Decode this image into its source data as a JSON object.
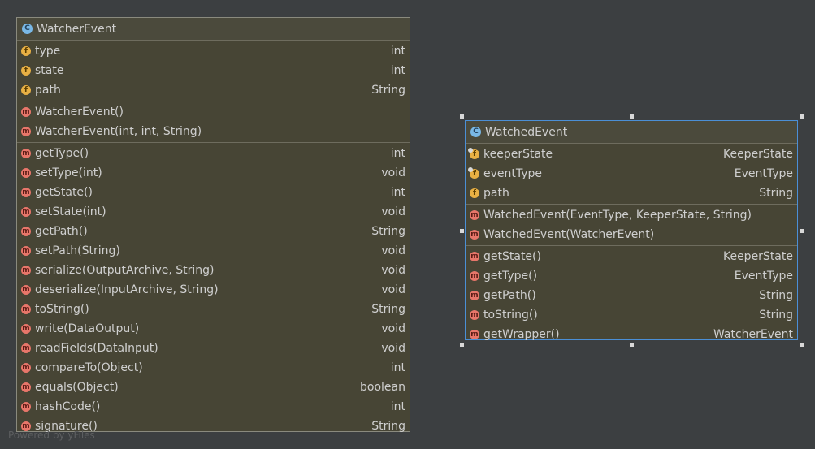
{
  "watcher": {
    "title": "WatcherEvent",
    "fields": [
      {
        "name": "type",
        "type": "int"
      },
      {
        "name": "state",
        "type": "int"
      },
      {
        "name": "path",
        "type": "String"
      }
    ],
    "constructors": [
      {
        "name": "WatcherEvent()",
        "type": ""
      },
      {
        "name": "WatcherEvent(int, int, String)",
        "type": ""
      }
    ],
    "methods": [
      {
        "name": "getType()",
        "type": "int"
      },
      {
        "name": "setType(int)",
        "type": "void"
      },
      {
        "name": "getState()",
        "type": "int"
      },
      {
        "name": "setState(int)",
        "type": "void"
      },
      {
        "name": "getPath()",
        "type": "String"
      },
      {
        "name": "setPath(String)",
        "type": "void"
      },
      {
        "name": "serialize(OutputArchive, String)",
        "type": "void"
      },
      {
        "name": "deserialize(InputArchive, String)",
        "type": "void"
      },
      {
        "name": "toString()",
        "type": "String"
      },
      {
        "name": "write(DataOutput)",
        "type": "void"
      },
      {
        "name": "readFields(DataInput)",
        "type": "void"
      },
      {
        "name": "compareTo(Object)",
        "type": "int"
      },
      {
        "name": "equals(Object)",
        "type": "boolean"
      },
      {
        "name": "hashCode()",
        "type": "int"
      },
      {
        "name": "signature()",
        "type": "String"
      }
    ]
  },
  "watched": {
    "title": "WatchedEvent",
    "fields": [
      {
        "name": "keeperState",
        "type": "KeeperState"
      },
      {
        "name": "eventType",
        "type": "EventType"
      },
      {
        "name": "path",
        "type": "String"
      }
    ],
    "constructors": [
      {
        "name": "WatchedEvent(EventType, KeeperState, String)",
        "type": ""
      },
      {
        "name": "WatchedEvent(WatcherEvent)",
        "type": ""
      }
    ],
    "methods": [
      {
        "name": "getState()",
        "type": "KeeperState"
      },
      {
        "name": "getType()",
        "type": "EventType"
      },
      {
        "name": "getPath()",
        "type": "String"
      },
      {
        "name": "toString()",
        "type": "String"
      },
      {
        "name": "getWrapper()",
        "type": "WatcherEvent"
      }
    ]
  },
  "icons": {
    "class": "C",
    "field": "f",
    "method": "m"
  },
  "watermark": "Powered by yFiles",
  "colors": {
    "background": "#3c3f41",
    "node_fill": "#474535",
    "selection": "#4b8fd6"
  }
}
